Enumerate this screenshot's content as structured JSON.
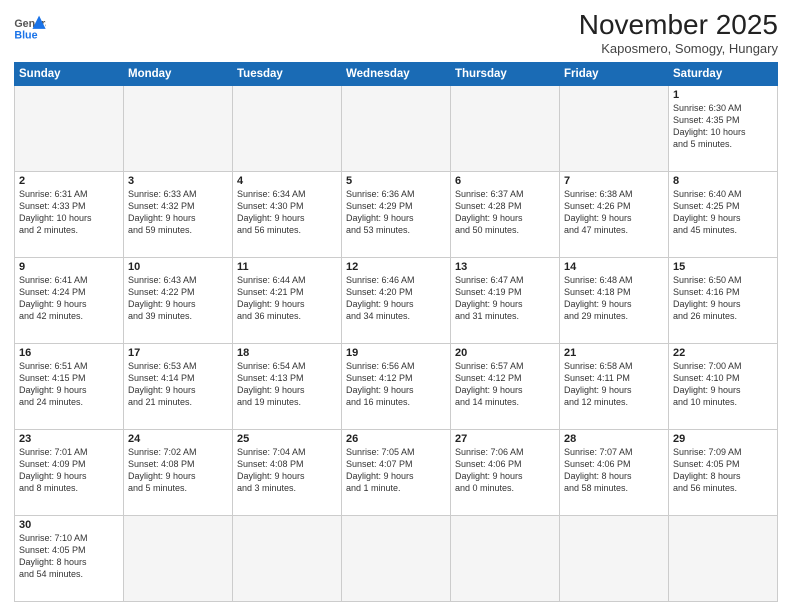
{
  "logo": {
    "general": "General",
    "blue": "Blue"
  },
  "title": "November 2025",
  "location": "Kaposmero, Somogy, Hungary",
  "days_of_week": [
    "Sunday",
    "Monday",
    "Tuesday",
    "Wednesday",
    "Thursday",
    "Friday",
    "Saturday"
  ],
  "weeks": [
    [
      {
        "day": "",
        "info": ""
      },
      {
        "day": "",
        "info": ""
      },
      {
        "day": "",
        "info": ""
      },
      {
        "day": "",
        "info": ""
      },
      {
        "day": "",
        "info": ""
      },
      {
        "day": "",
        "info": ""
      },
      {
        "day": "1",
        "info": "Sunrise: 6:30 AM\nSunset: 4:35 PM\nDaylight: 10 hours\nand 5 minutes."
      }
    ],
    [
      {
        "day": "2",
        "info": "Sunrise: 6:31 AM\nSunset: 4:33 PM\nDaylight: 10 hours\nand 2 minutes."
      },
      {
        "day": "3",
        "info": "Sunrise: 6:33 AM\nSunset: 4:32 PM\nDaylight: 9 hours\nand 59 minutes."
      },
      {
        "day": "4",
        "info": "Sunrise: 6:34 AM\nSunset: 4:30 PM\nDaylight: 9 hours\nand 56 minutes."
      },
      {
        "day": "5",
        "info": "Sunrise: 6:36 AM\nSunset: 4:29 PM\nDaylight: 9 hours\nand 53 minutes."
      },
      {
        "day": "6",
        "info": "Sunrise: 6:37 AM\nSunset: 4:28 PM\nDaylight: 9 hours\nand 50 minutes."
      },
      {
        "day": "7",
        "info": "Sunrise: 6:38 AM\nSunset: 4:26 PM\nDaylight: 9 hours\nand 47 minutes."
      },
      {
        "day": "8",
        "info": "Sunrise: 6:40 AM\nSunset: 4:25 PM\nDaylight: 9 hours\nand 45 minutes."
      }
    ],
    [
      {
        "day": "9",
        "info": "Sunrise: 6:41 AM\nSunset: 4:24 PM\nDaylight: 9 hours\nand 42 minutes."
      },
      {
        "day": "10",
        "info": "Sunrise: 6:43 AM\nSunset: 4:22 PM\nDaylight: 9 hours\nand 39 minutes."
      },
      {
        "day": "11",
        "info": "Sunrise: 6:44 AM\nSunset: 4:21 PM\nDaylight: 9 hours\nand 36 minutes."
      },
      {
        "day": "12",
        "info": "Sunrise: 6:46 AM\nSunset: 4:20 PM\nDaylight: 9 hours\nand 34 minutes."
      },
      {
        "day": "13",
        "info": "Sunrise: 6:47 AM\nSunset: 4:19 PM\nDaylight: 9 hours\nand 31 minutes."
      },
      {
        "day": "14",
        "info": "Sunrise: 6:48 AM\nSunset: 4:18 PM\nDaylight: 9 hours\nand 29 minutes."
      },
      {
        "day": "15",
        "info": "Sunrise: 6:50 AM\nSunset: 4:16 PM\nDaylight: 9 hours\nand 26 minutes."
      }
    ],
    [
      {
        "day": "16",
        "info": "Sunrise: 6:51 AM\nSunset: 4:15 PM\nDaylight: 9 hours\nand 24 minutes."
      },
      {
        "day": "17",
        "info": "Sunrise: 6:53 AM\nSunset: 4:14 PM\nDaylight: 9 hours\nand 21 minutes."
      },
      {
        "day": "18",
        "info": "Sunrise: 6:54 AM\nSunset: 4:13 PM\nDaylight: 9 hours\nand 19 minutes."
      },
      {
        "day": "19",
        "info": "Sunrise: 6:56 AM\nSunset: 4:12 PM\nDaylight: 9 hours\nand 16 minutes."
      },
      {
        "day": "20",
        "info": "Sunrise: 6:57 AM\nSunset: 4:12 PM\nDaylight: 9 hours\nand 14 minutes."
      },
      {
        "day": "21",
        "info": "Sunrise: 6:58 AM\nSunset: 4:11 PM\nDaylight: 9 hours\nand 12 minutes."
      },
      {
        "day": "22",
        "info": "Sunrise: 7:00 AM\nSunset: 4:10 PM\nDaylight: 9 hours\nand 10 minutes."
      }
    ],
    [
      {
        "day": "23",
        "info": "Sunrise: 7:01 AM\nSunset: 4:09 PM\nDaylight: 9 hours\nand 8 minutes."
      },
      {
        "day": "24",
        "info": "Sunrise: 7:02 AM\nSunset: 4:08 PM\nDaylight: 9 hours\nand 5 minutes."
      },
      {
        "day": "25",
        "info": "Sunrise: 7:04 AM\nSunset: 4:08 PM\nDaylight: 9 hours\nand 3 minutes."
      },
      {
        "day": "26",
        "info": "Sunrise: 7:05 AM\nSunset: 4:07 PM\nDaylight: 9 hours\nand 1 minute."
      },
      {
        "day": "27",
        "info": "Sunrise: 7:06 AM\nSunset: 4:06 PM\nDaylight: 9 hours\nand 0 minutes."
      },
      {
        "day": "28",
        "info": "Sunrise: 7:07 AM\nSunset: 4:06 PM\nDaylight: 8 hours\nand 58 minutes."
      },
      {
        "day": "29",
        "info": "Sunrise: 7:09 AM\nSunset: 4:05 PM\nDaylight: 8 hours\nand 56 minutes."
      }
    ],
    [
      {
        "day": "30",
        "info": "Sunrise: 7:10 AM\nSunset: 4:05 PM\nDaylight: 8 hours\nand 54 minutes."
      },
      {
        "day": "",
        "info": ""
      },
      {
        "day": "",
        "info": ""
      },
      {
        "day": "",
        "info": ""
      },
      {
        "day": "",
        "info": ""
      },
      {
        "day": "",
        "info": ""
      },
      {
        "day": "",
        "info": ""
      }
    ]
  ]
}
